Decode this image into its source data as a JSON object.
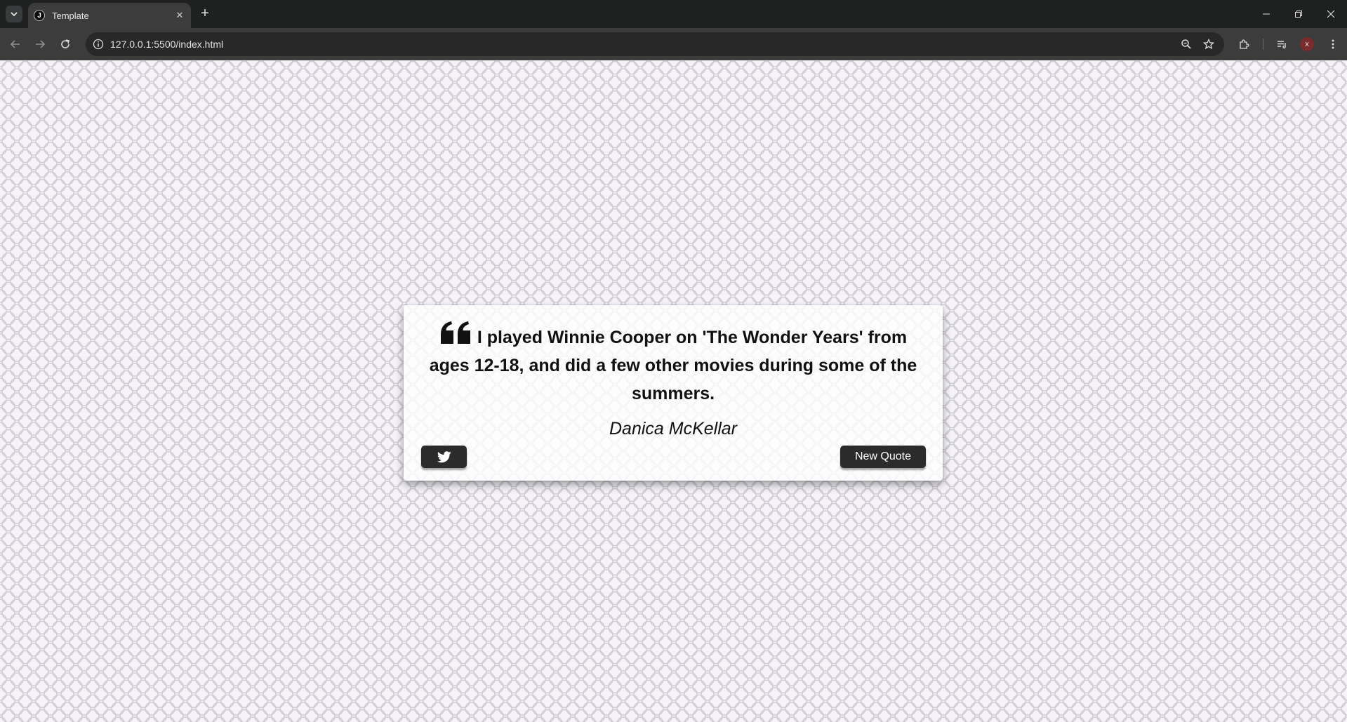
{
  "browser": {
    "tab": {
      "favicon_letter": "J",
      "title": "Template"
    },
    "url": "127.0.0.1:5500/index.html",
    "profile_initial": "x"
  },
  "quote": {
    "text": "I played Winnie Cooper on 'The Wonder Years' from ages 12-18, and did a few other movies during some of the summers.",
    "author": "Danica McKellar"
  },
  "buttons": {
    "tweet_icon": "twitter-icon",
    "new_quote_label": "New Quote"
  },
  "colors": {
    "button_bg": "#2b2b2b",
    "background": "#f5f3f8"
  }
}
